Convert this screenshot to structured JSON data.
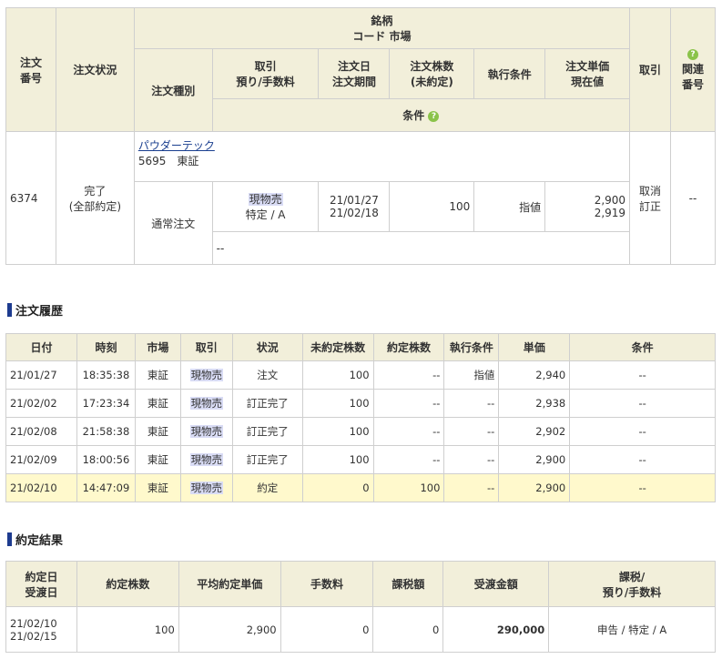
{
  "order": {
    "headers": {
      "order_no": "注文\n番号",
      "status": "注文状況",
      "meigara": "銘柄",
      "code_market": "コード 市場",
      "order_type": "注文種別",
      "torihiki": "取引\n預り/手数料",
      "order_date": "注文日\n注文期間",
      "shares": "注文株数\n(未約定)",
      "exec_cond": "執行条件",
      "unit_price": "注文単価\n現在値",
      "torikeshi": "取引",
      "related": "関連\n番号",
      "conditions": "条件"
    },
    "row": {
      "order_no": "6374",
      "status": "完了\n(全部約定)",
      "stock_name": "パウダーテック",
      "stock_code_market": "5695　東証",
      "order_type": "通常注文",
      "trade": "現物売",
      "account": "特定 / A",
      "order_date": "21/01/27\n21/02/18",
      "shares": "100",
      "exec_cond": "指値",
      "unit_price": "2,900\n2,919",
      "actions": "取消\n訂正",
      "related": "--",
      "conditions": "--"
    }
  },
  "history": {
    "title": "注文履歴",
    "columns": [
      "日付",
      "時刻",
      "市場",
      "取引",
      "状況",
      "未約定株数",
      "約定株数",
      "執行条件",
      "単価",
      "条件"
    ],
    "rows": [
      [
        "21/01/27",
        "18:35:38",
        "東証",
        "現物売",
        "注文",
        "100",
        "--",
        "指値",
        "2,940",
        "--"
      ],
      [
        "21/02/02",
        "17:23:34",
        "東証",
        "現物売",
        "訂正完了",
        "100",
        "--",
        "--",
        "2,938",
        "--"
      ],
      [
        "21/02/08",
        "21:58:38",
        "東証",
        "現物売",
        "訂正完了",
        "100",
        "--",
        "--",
        "2,902",
        "--"
      ],
      [
        "21/02/09",
        "18:00:56",
        "東証",
        "現物売",
        "訂正完了",
        "100",
        "--",
        "--",
        "2,900",
        "--"
      ],
      [
        "21/02/10",
        "14:47:09",
        "東証",
        "現物売",
        "約定",
        "0",
        "100",
        "--",
        "2,900",
        "--"
      ]
    ]
  },
  "results": {
    "title": "約定結果",
    "columns": [
      "約定日\n受渡日",
      "約定株数",
      "平均約定単価",
      "手数料",
      "課税額",
      "受渡金額",
      "課税/\n預り/手数料"
    ],
    "row": {
      "dates": "21/02/10\n21/02/15",
      "shares": "100",
      "avg_price": "2,900",
      "fee": "0",
      "tax": "0",
      "amount": "290,000",
      "tax_account": "申告 / 特定 / A"
    }
  },
  "colors": {
    "header_bg": "#f2efda",
    "highlight_row": "#fff9cc",
    "section_bar": "#1d3b8f",
    "help_icon": "#8bc34a"
  },
  "icons": {
    "help": "help-icon"
  }
}
